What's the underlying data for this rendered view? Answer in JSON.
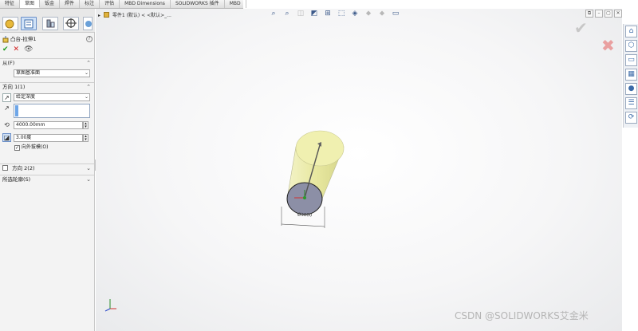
{
  "tabs": [
    {
      "label": "特征",
      "active": false
    },
    {
      "label": "草图",
      "active": true
    },
    {
      "label": "钣金",
      "active": false
    },
    {
      "label": "焊件",
      "active": false
    },
    {
      "label": "标注",
      "active": false
    },
    {
      "label": "评估",
      "active": false
    },
    {
      "label": "MBD Dimensions",
      "active": false
    },
    {
      "label": "SOLIDWORKS 插件",
      "active": false
    },
    {
      "label": "MBD",
      "active": false
    }
  ],
  "feature_manager": {
    "title": "凸台-拉伸1",
    "help": "?",
    "from_section": {
      "label": "从(F)",
      "value": "草图基准面"
    },
    "direction1": {
      "label": "方向 1(1)",
      "end_condition": "给定深度",
      "depth": "4000.00mm",
      "draft_angle": "3.00度",
      "draft_outward": "向外拔模(O)"
    },
    "direction2": {
      "label": "方向 2(2)"
    },
    "selected_contours": {
      "label": "所选轮廓(S)"
    }
  },
  "viewport": {
    "breadcrumb": "零件1 (默认) < <默认>_...",
    "dimension_label": "Ø3000"
  },
  "watermark": "CSDN @SOLIDWORKS艾金米",
  "colors": {
    "accent": "#4a90d9",
    "cylinder_top": "#f0f0b0",
    "cylinder_bottom": "#8c8fa6",
    "ok_green": "#1a9b1a",
    "cancel_red": "#d21f1f"
  }
}
